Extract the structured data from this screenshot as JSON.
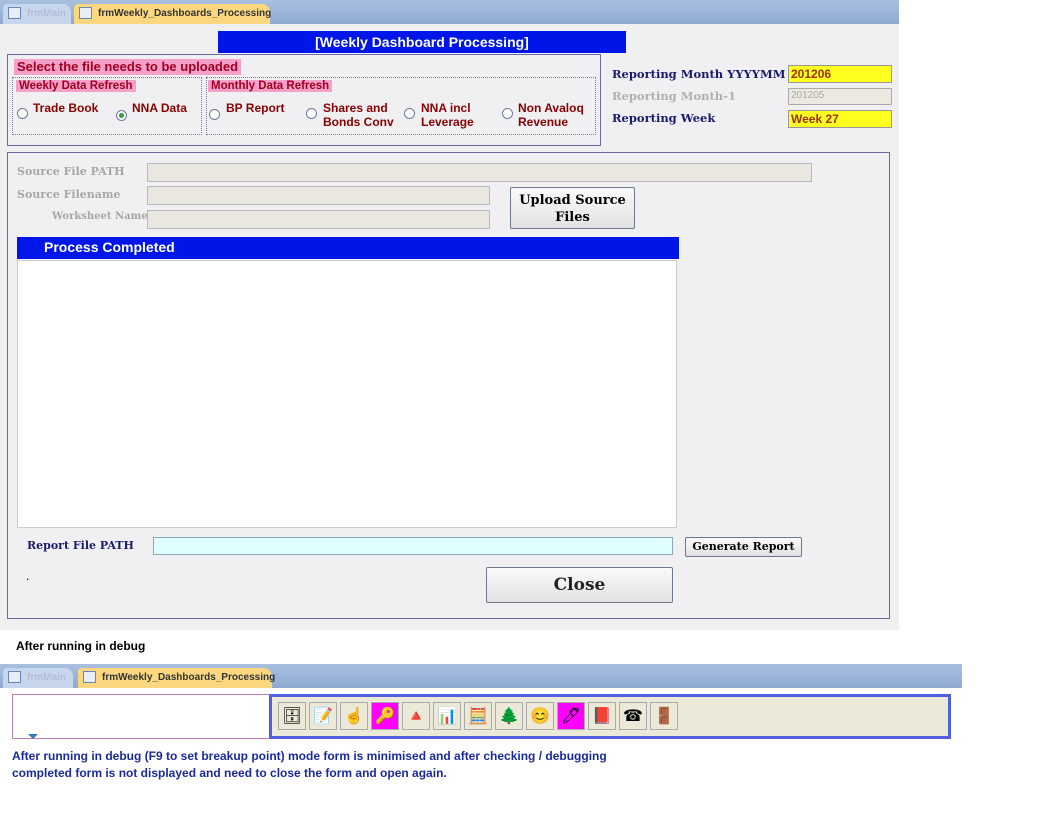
{
  "tabs": [
    {
      "label": "frmMain"
    },
    {
      "label": "frmWeekly_Dashboards_Processing"
    }
  ],
  "form_title": "[Weekly Dashboard Processing]",
  "select_section": {
    "title": "Select the file needs to be uploaded",
    "weekly": {
      "title": "Weekly Data Refresh",
      "options": [
        {
          "label": "Trade Book",
          "selected": false
        },
        {
          "label": "NNA Data",
          "selected": true
        }
      ]
    },
    "monthly": {
      "title": "Monthly Data Refresh",
      "options": [
        {
          "label": "BP Report"
        },
        {
          "label": "Shares and Bonds Conv"
        },
        {
          "label": "NNA incl Leverage"
        },
        {
          "label": "Non Avaloq Revenue"
        }
      ]
    }
  },
  "reporting": {
    "month_label": "Reporting Month YYYYMM",
    "month_value": "201206",
    "prev_label": "Reporting Month-1",
    "prev_value": "201205",
    "week_label": "Reporting Week",
    "week_value": "Week 27"
  },
  "source": {
    "path_label": "Source File PATH",
    "filename_label": "Source Filename",
    "worksheet_label": "Worksheet Name",
    "upload_button": "Upload Source Files"
  },
  "process": {
    "header": "Process Completed"
  },
  "report": {
    "path_label": "Report File PATH",
    "generate_button": "Generate Report",
    "dot": ".",
    "close_button": "Close"
  },
  "debug_caption": "After running in debug",
  "toolbar_icons": [
    "cabinet",
    "notepad",
    "pointing-hand",
    "key",
    "shapes",
    "chart",
    "calculator",
    "tree",
    "smiley",
    "pen",
    "help-book",
    "telephone",
    "exit-door"
  ],
  "note": "After running in debug (F9 to set breakup point) mode form is minimised and after checking / debugging completed form is not displayed and need to close the form and open again."
}
